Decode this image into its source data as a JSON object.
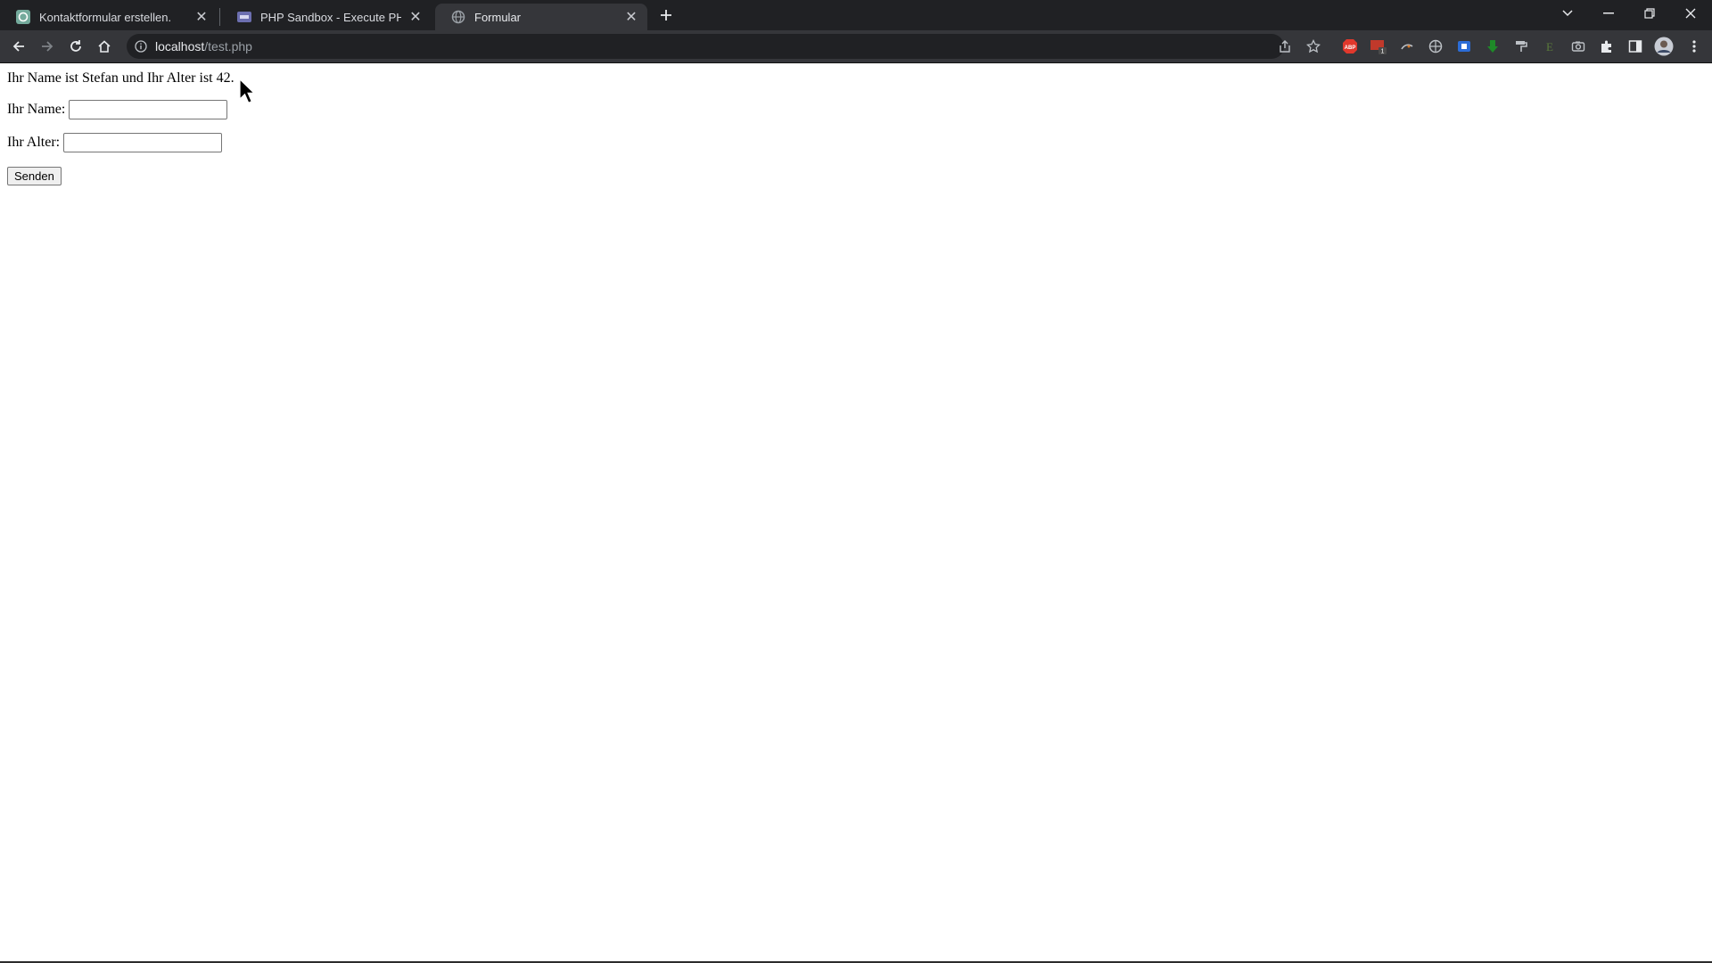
{
  "browser": {
    "tabs": [
      {
        "title": "Kontaktformular erstellen.",
        "icon": "openai-icon",
        "active": false
      },
      {
        "title": "PHP Sandbox - Execute PHP cod",
        "icon": "php-icon",
        "active": false
      },
      {
        "title": "Formular",
        "icon": "globe-icon",
        "active": true
      }
    ],
    "address": {
      "host": "localhost",
      "path": "/test.php"
    },
    "extensions": [
      "share-icon",
      "bookmark-star-icon",
      "abp-icon",
      "counter-extension-icon",
      "dark-reader-icon",
      "vpn-globe-icon",
      "blue-extension-icon",
      "download-arrow-icon",
      "paint-roller-icon",
      "evernote-icon",
      "camera-icon",
      "puzzle-icon",
      "side-panel-icon",
      "avatar",
      "kebab-menu-icon"
    ],
    "colors": {
      "tabstrip": "#202124",
      "toolbar": "#35363a",
      "omnibox": "#202124"
    }
  },
  "page": {
    "result_text": "Ihr Name ist Stefan und Ihr Alter ist 42.",
    "name_label": "Ihr Name:",
    "name_value": "",
    "age_label": "Ihr Alter:",
    "age_value": "",
    "submit_label": "Senden"
  }
}
